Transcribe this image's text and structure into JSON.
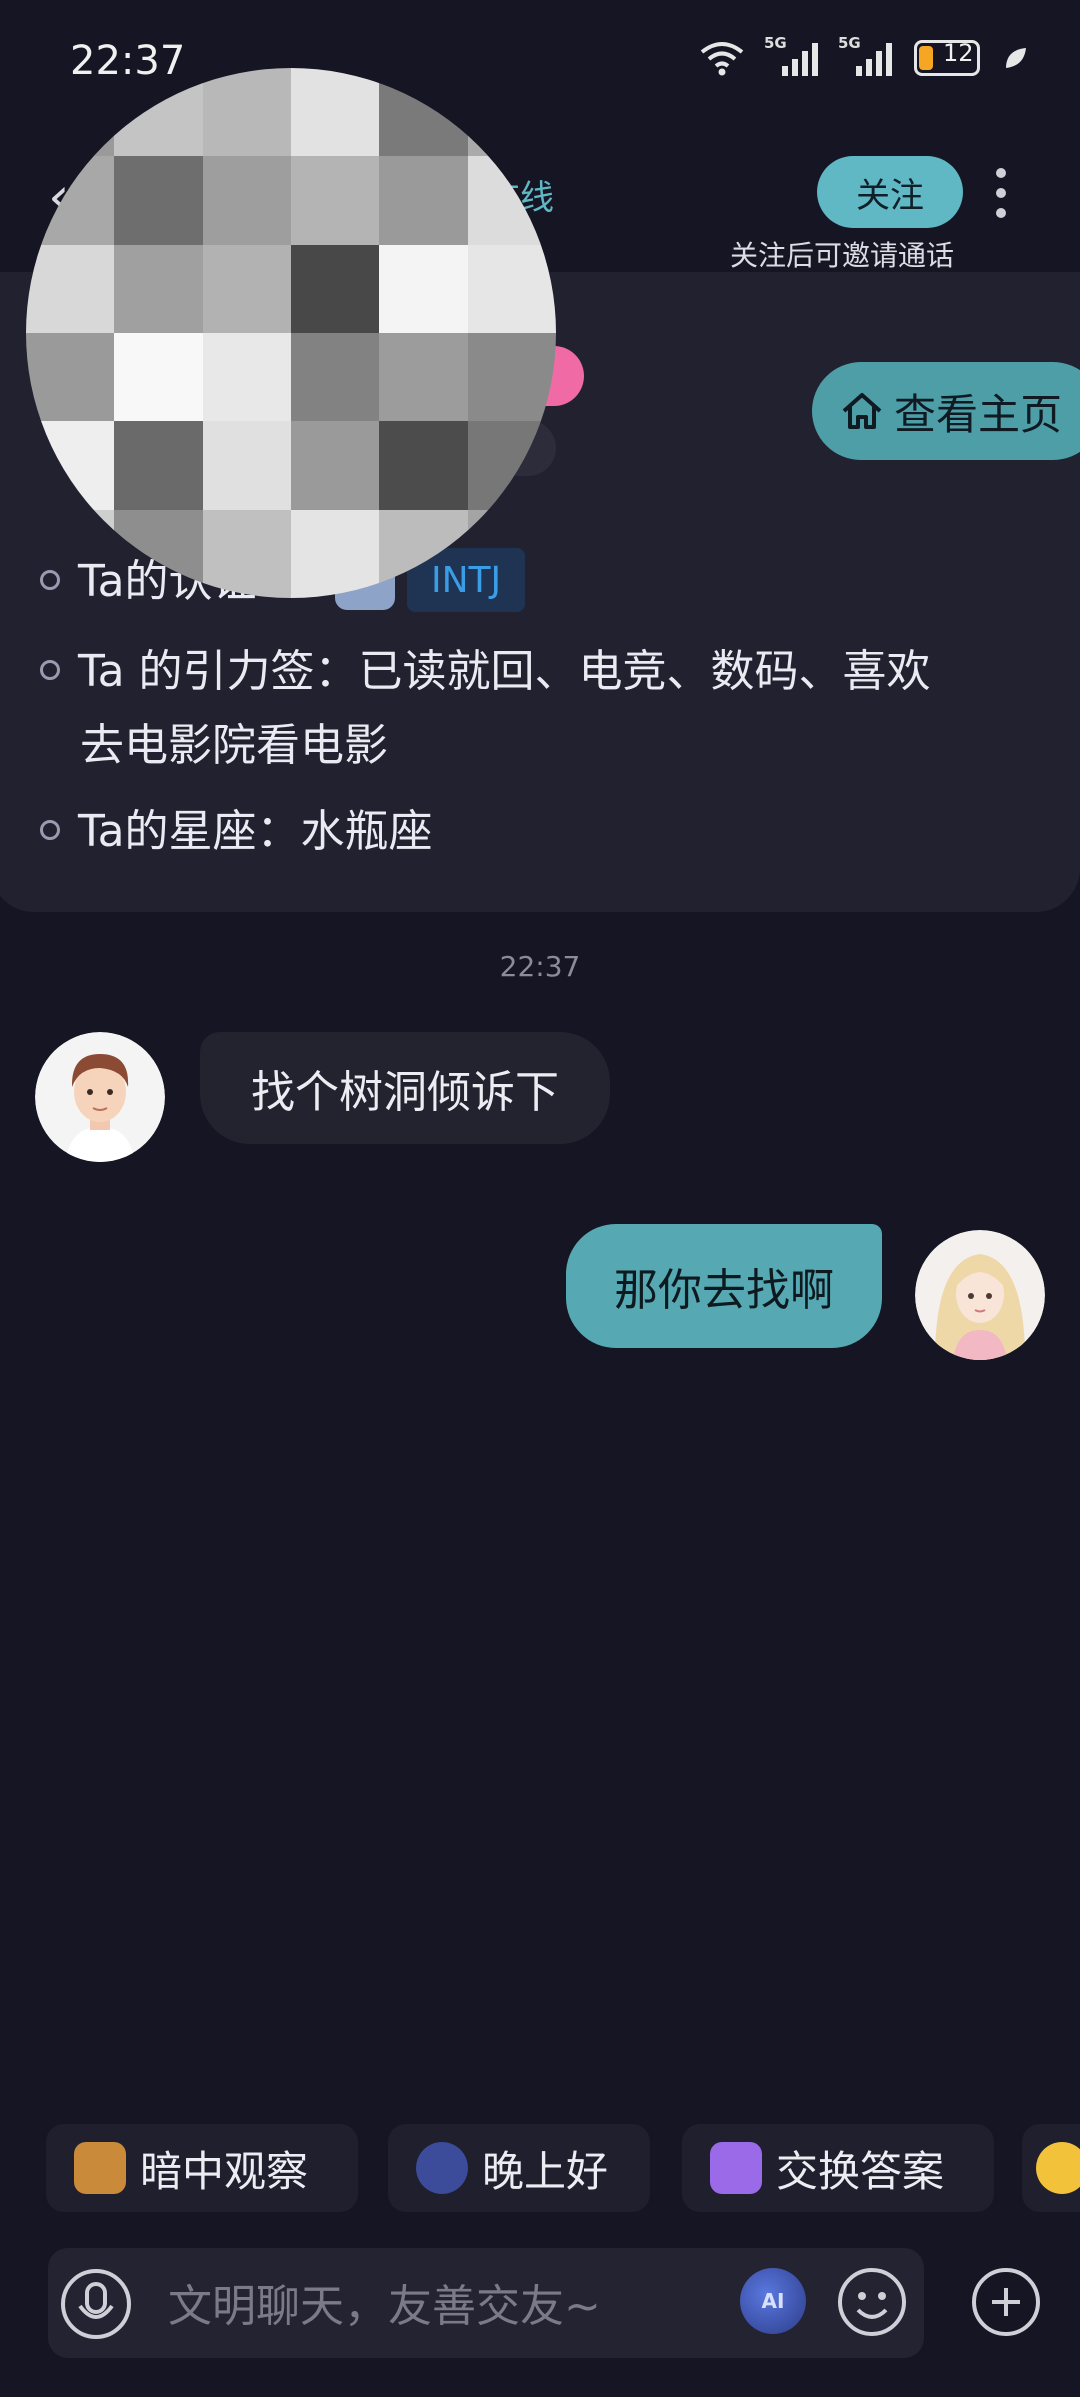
{
  "status_bar": {
    "time": "22:37",
    "network_1": "5G",
    "network_2": "5G",
    "battery": "12"
  },
  "header": {
    "online_status": "在线",
    "follow_button": "关注",
    "follow_hint": "关注后可邀请通话"
  },
  "profile": {
    "home_button": "查看主页",
    "mbti_label": "Ta的认证：",
    "mbti_value": "INTJ",
    "tags_line1": "Ta 的引力签：已读就回、电竞、数码、喜欢",
    "tags_line2": "去电影院看电影",
    "zodiac": "Ta的星座：水瓶座"
  },
  "chat": {
    "time": "22:37",
    "messages": [
      {
        "side": "left",
        "text": "找个树洞倾诉下"
      },
      {
        "side": "right",
        "text": "那你去找啊"
      }
    ]
  },
  "quick_replies": [
    "暗中观察",
    "晚上好",
    "交换答案"
  ],
  "input": {
    "placeholder": "文明聊天，友善交友~"
  },
  "colors": {
    "accent": "#5fb8c4",
    "background": "#151523",
    "card": "#21212f"
  }
}
